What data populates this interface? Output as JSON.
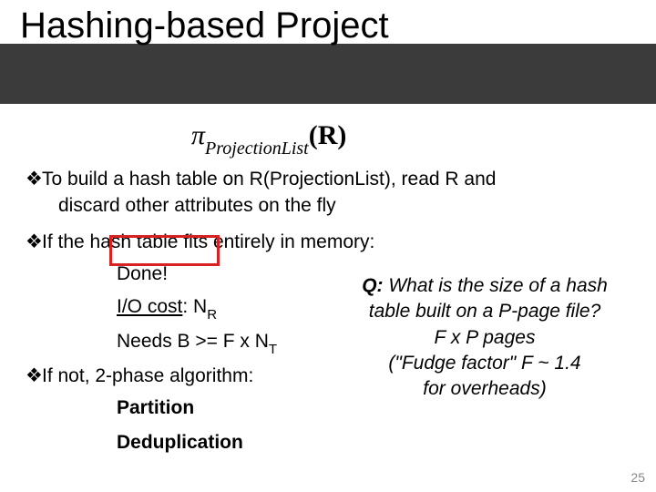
{
  "title": "Hashing-based Project",
  "formula": {
    "pi": "π",
    "sub": "ProjectionList",
    "arg": "(R)"
  },
  "bullets": {
    "b1a": "To build a hash table on R(ProjectionList), read R and",
    "b1b": "discard other attributes on the fly",
    "b2": "If the hash table fits entirely in memory:",
    "b2a": "Done!",
    "b2b_label": "I/O cost",
    "b2b_colon": ": N",
    "b2b_sub": "R",
    "b2c_a": "Needs B >= F x N",
    "b2c_sub": "T",
    "b3": "If not, 2-phase algorithm:",
    "b3a": "Partition",
    "b3b": "Deduplication"
  },
  "callout": {
    "q_label": "Q:",
    "l1": " What is the size of a hash",
    "l2": "table built on a P-page file?",
    "l3": "F x P pages",
    "l4a": "(\"Fudge factor\" F ~ 1.4",
    "l4b": "for overheads)"
  },
  "pagenum": "25"
}
